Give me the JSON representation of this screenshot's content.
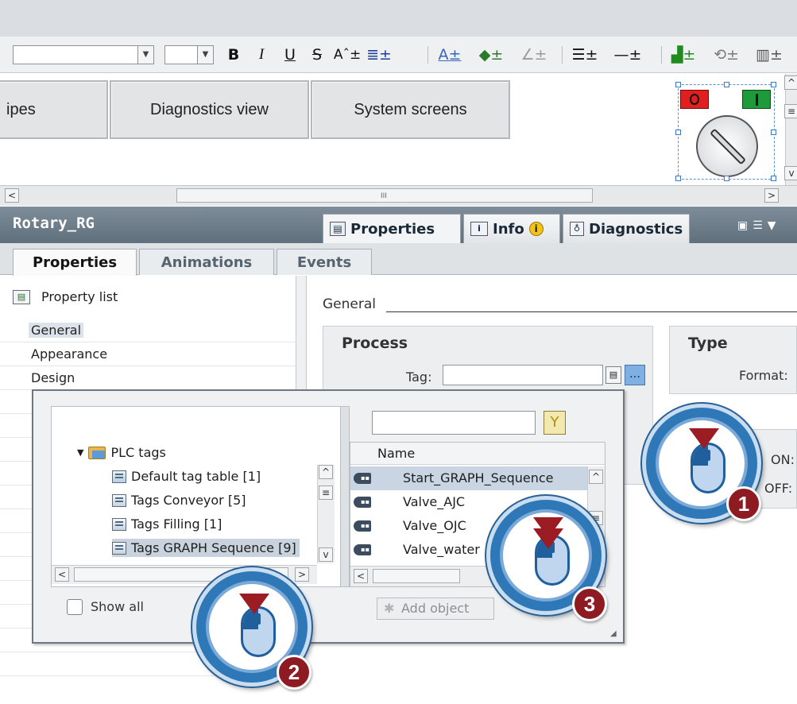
{
  "toolbar": {
    "font_combo": "",
    "size_combo": "",
    "bold": "B",
    "italic": "I",
    "underline": "U",
    "strike": "S"
  },
  "screens": {
    "partial": "ipes",
    "diagnostics": "Diagnostics view",
    "system": "System screens"
  },
  "inspector": {
    "object_name": "Rotary_RG",
    "tabs": [
      "Properties",
      "Info",
      "Diagnostics"
    ],
    "sub_tabs": [
      "Properties",
      "Animations",
      "Events"
    ],
    "property_list": "Property list",
    "nav": [
      "General",
      "Appearance",
      "Design"
    ],
    "section": "General",
    "process_title": "Process",
    "tag_label": "Tag:",
    "tag_value": "",
    "type_title": "Type",
    "format_label": "Format:",
    "on_label": "ON:",
    "off_label": "OFF:"
  },
  "popup": {
    "tree": [
      {
        "label": "PLC tags",
        "icon": "folder"
      },
      {
        "label": "Default tag table [1]",
        "icon": "tag-table-default"
      },
      {
        "label": "Tags Conveyor [5]",
        "icon": "tag-table"
      },
      {
        "label": "Tags Filling [1]",
        "icon": "tag-table"
      },
      {
        "label": "Tags GRAPH Sequence [9]",
        "icon": "tag-table"
      }
    ],
    "filter_value": "",
    "list_header": "Name",
    "list": [
      "Start_GRAPH_Sequence",
      "Valve_AJC",
      "Valve_OJC",
      "Valve_water"
    ],
    "show_all": "Show all",
    "add_object": "Add object"
  },
  "callouts": [
    "1",
    "2",
    "3"
  ],
  "colors": {
    "accent_blue": "#2f78b8",
    "step_number": "#8e1b22",
    "header": "#6a7a87"
  }
}
